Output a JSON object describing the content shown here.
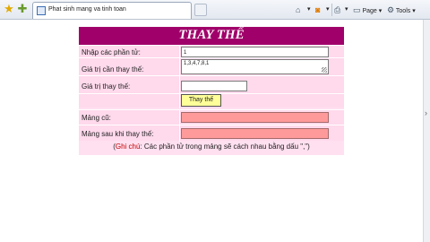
{
  "browser": {
    "tab_title": "Phat sinh mang va tinh toan",
    "page_label": "Page",
    "tools_label": "Tools"
  },
  "form": {
    "title": "THAY THẾ",
    "fields": [
      {
        "label": "Nhập các phần tử:",
        "value": "1"
      },
      {
        "label": "Giá trị cần thay thế:",
        "value": "1,3,4,7,8,1"
      },
      {
        "label": "Giá trị thay thế:",
        "value": ""
      },
      {
        "label": "Mảng cũ:",
        "value": ""
      },
      {
        "label": "Mảng sau khi thay thế:",
        "value": ""
      }
    ],
    "button_label": "Thay thế",
    "note_prefix": "(",
    "note_key": "Ghi chú",
    "note_text": ": Các phần tử trong mảng sẽ cách nhau bằng dấu \",\")"
  },
  "colors": {
    "header_bg": "#a0006a",
    "form_bg": "#ffd9ec",
    "result_field": "#ff9a9a",
    "button_bg": "#ffff99",
    "note_key": "#c00000"
  },
  "icons": [
    "favorites-star-icon",
    "add-favorites-icon",
    "page-icon",
    "home-icon",
    "feeds-icon",
    "print-icon",
    "page-menu-icon",
    "tools-icon"
  ]
}
